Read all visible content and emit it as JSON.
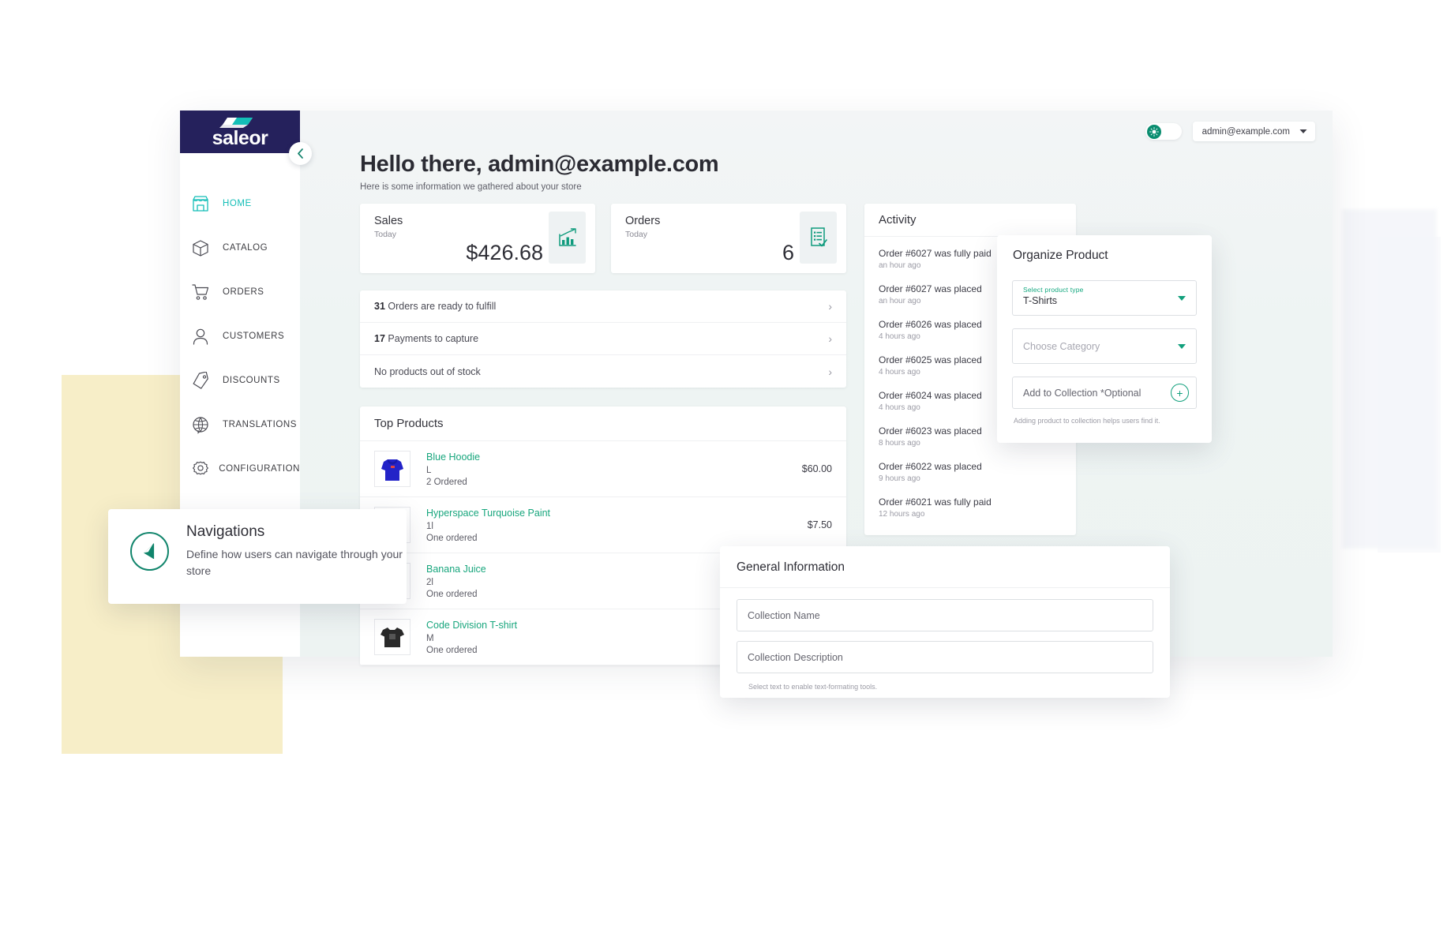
{
  "sidebar": {
    "logo_text": "saleor",
    "collapse_icon": "chevron-left-icon",
    "items": [
      {
        "label": "HOME",
        "icon": "store-icon",
        "active": true
      },
      {
        "label": "CATALOG",
        "icon": "box-icon",
        "active": false
      },
      {
        "label": "ORDERS",
        "icon": "cart-icon",
        "active": false
      },
      {
        "label": "CUSTOMERS",
        "icon": "user-icon",
        "active": false
      },
      {
        "label": "DISCOUNTS",
        "icon": "tag-icon",
        "active": false
      },
      {
        "label": "TRANSLATIONS",
        "icon": "globe-icon",
        "active": false
      },
      {
        "label": "CONFIGURATION",
        "icon": "gear-icon",
        "active": false
      }
    ]
  },
  "topbar": {
    "theme_icon": "theme-toggle-icon",
    "account_email": "admin@example.com",
    "account_caret": "chevron-down-icon"
  },
  "greeting": {
    "title": "Hello there, admin@example.com",
    "subtitle": "Here is some information we gathered about your store"
  },
  "stats": [
    {
      "title": "Sales",
      "period": "Today",
      "value": "$426.68",
      "icon": "bar-chart-up-icon"
    },
    {
      "title": "Orders",
      "period": "Today",
      "value": "6",
      "icon": "order-list-check-icon"
    }
  ],
  "actions": [
    {
      "count": "31",
      "text": "Orders are ready to fulfill",
      "chevron": "chevron-right-icon"
    },
    {
      "count": "17",
      "text": "Payments to capture",
      "chevron": "chevron-right-icon"
    },
    {
      "count": "",
      "text": "No products out of stock",
      "chevron": "chevron-right-icon"
    }
  ],
  "top_products": {
    "heading": "Top Products",
    "items": [
      {
        "name": "Blue Hoodie",
        "variant": "L",
        "ordered": "2 Ordered",
        "price": "$60.00",
        "thumb": "blue-hoodie-thumb"
      },
      {
        "name": "Hyperspace Turquoise Paint",
        "variant": "1l",
        "ordered": "One ordered",
        "price": "$7.50",
        "thumb": "paint-thumb"
      },
      {
        "name": "Banana Juice",
        "variant": "2l",
        "ordered": "One ordered",
        "price": "",
        "thumb": "juice-thumb"
      },
      {
        "name": "Code Division T-shirt",
        "variant": "M",
        "ordered": "One ordered",
        "price": "",
        "thumb": "tshirt-thumb"
      }
    ]
  },
  "activity": {
    "heading": "Activity",
    "items": [
      {
        "text": "Order #6027 was fully paid",
        "time": "an hour ago"
      },
      {
        "text": "Order #6027 was placed",
        "time": "an hour ago"
      },
      {
        "text": "Order #6026 was placed",
        "time": "4 hours ago"
      },
      {
        "text": "Order #6025 was placed",
        "time": "4 hours ago"
      },
      {
        "text": "Order #6024 was placed",
        "time": "4 hours ago"
      },
      {
        "text": "Order #6023 was placed",
        "time": "8 hours ago"
      },
      {
        "text": "Order #6022 was placed",
        "time": "9 hours ago"
      },
      {
        "text": "Order #6021 was fully paid",
        "time": "12 hours ago"
      }
    ]
  },
  "organize_product": {
    "title": "Organize Product",
    "product_type_label": "Select product type",
    "product_type_value": "T-Shirts",
    "category_placeholder": "Choose Category",
    "collection_label": "Add to Collection *Optional",
    "add_icon": "plus-circle-icon",
    "hint": "Adding product to collection helps users find it."
  },
  "general_information": {
    "title": "General Information",
    "name_placeholder": "Collection Name",
    "description_placeholder": "Collection Description",
    "hint": "Select text to enable text-formating tools."
  },
  "navigations_card": {
    "icon": "navigation-arrow-icon",
    "title": "Navigations",
    "description": "Define how users can navigate through your store"
  },
  "colors": {
    "brand_navy": "#25215c",
    "accent_teal": "#13beb7",
    "link_green": "#18a67d",
    "app_bg": "#eef4f3",
    "deco_yellow": "#f7eec8"
  }
}
